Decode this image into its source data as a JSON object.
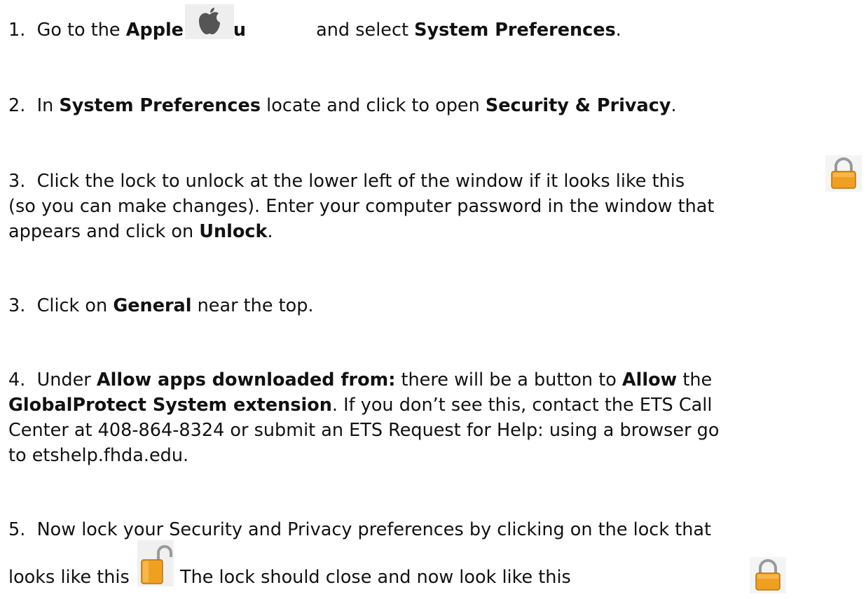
{
  "steps": [
    {
      "num": "1.",
      "t1": "Go to the ",
      "b1": "Apple menu",
      "t2": "and select ",
      "b2": "System Preferences",
      "t3": "."
    },
    {
      "num": "2.",
      "t1": "In ",
      "b1": "System Preferences",
      "t2": " locate and click to open ",
      "b2": "Security & Privacy",
      "t3": "."
    },
    {
      "num": "3.",
      "l1": "Click the lock to unlock at the lower left of the window if it looks like this",
      "l2": "(so you can make changes). Enter your computer password in the window that",
      "l3a": "appears and click on ",
      "l3b": "Unlock",
      "l3c": "."
    },
    {
      "num": "3.",
      "t1": "Click on ",
      "b1": "General",
      "t2": " near the top."
    },
    {
      "num": "4.",
      "l1a": "Under ",
      "l1b": "Allow apps downloaded from:",
      "l1c": " there will be a button to ",
      "l1d": "Allow",
      "l1e": " the",
      "l2a": "GlobalProtect System extension",
      "l2b": ". If you don’t see this, contact the ETS Call",
      "l3": "Center at 408-864-8324 or submit an ETS Request for Help: using a browser go",
      "l4": "to etshelp.fhda.edu."
    },
    {
      "num": "5.",
      "l1": "Now lock your Security and Privacy preferences by clicking on the lock that",
      "l2a": "looks like this",
      "l2b": ". The lock should close and now look like this"
    }
  ],
  "icons": {
    "apple": "apple-logo-icon",
    "locked": "lock-closed-icon",
    "unlocked": "lock-open-icon",
    "lock_color": "#F0A020"
  }
}
